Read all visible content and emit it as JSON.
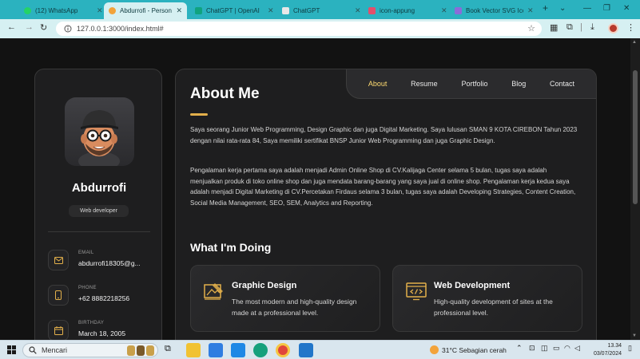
{
  "browser": {
    "tabs": [
      {
        "title": "(12) WhatsApp",
        "color": "#25d366",
        "active": false
      },
      {
        "title": "Abdurrofi - Personal",
        "color": "#f2a33a",
        "active": true
      },
      {
        "title": "ChatGPT | OpenAI",
        "color": "#10a37f",
        "active": false
      },
      {
        "title": "ChatGPT",
        "color": "#e8e8e8",
        "active": false
      },
      {
        "title": "icon-appung",
        "color": "#e34f6b",
        "active": false
      },
      {
        "title": "Book Vector SVG Ico",
        "color": "#8b6cd9",
        "active": false
      }
    ],
    "new_tab": "+",
    "url": "127.0.0.1:3000/index.html#",
    "window_controls": [
      "⌄",
      "—",
      "❐",
      "✕"
    ]
  },
  "sidebar": {
    "name": "Abdurrofi",
    "role": "Web developer",
    "contacts": [
      {
        "title": "EMAIL",
        "value": "abdurrofi18305@g...",
        "icon": "mail-icon"
      },
      {
        "title": "PHONE",
        "value": "+62 8882218256",
        "icon": "phone-icon"
      },
      {
        "title": "BIRTHDAY",
        "value": "March 18, 2005",
        "icon": "calendar-icon"
      }
    ]
  },
  "navbar": {
    "items": [
      "About",
      "Resume",
      "Portfolio",
      "Blog",
      "Contact"
    ],
    "active": "About"
  },
  "about": {
    "title": "About Me",
    "paragraphs": [
      "Saya seorang Junior Web Programming, Design Graphic dan juga Digital Marketing. Saya lulusan SMAN 9 KOTA CIREBON Tahun 2023 dengan nilai rata-rata 84, Saya memiliki sertifikat BNSP Junior Web Programming dan juga Graphic Design.",
      "Pengalaman kerja pertama saya adalah menjadi Admin Online Shop di CV.Kalijaga Center selama 5 bulan, tugas saya adalah menjualkan produk di toko online shop dan juga mendata barang-barang yang saya jual di online shop. Pengalaman kerja kedua saya adalah menjadi Digital Marketing di CV.Percetakan Firdaus selama 3 bulan, tugas saya adalah Developing Strategies, Content Creation, Social Media Management, SEO, SEM, Analytics and Reporting."
    ]
  },
  "doing": {
    "title": "What I'm Doing",
    "services": [
      {
        "title": "Graphic Design",
        "desc": "The most modern and high-quality design made at a professional level.",
        "icon": "design-icon"
      },
      {
        "title": "Web Development",
        "desc": "High-quality development of sites at the professional level.",
        "icon": "code-icon"
      }
    ]
  },
  "taskbar": {
    "search_placeholder": "Mencari",
    "weather": "31°C  Sebagian cerah",
    "time": "13.34",
    "date": "03/07/2024"
  },
  "colors": {
    "accent": "#ffdb70",
    "bar": "#e3b04b",
    "tab_strip": "#2bb2bf"
  }
}
